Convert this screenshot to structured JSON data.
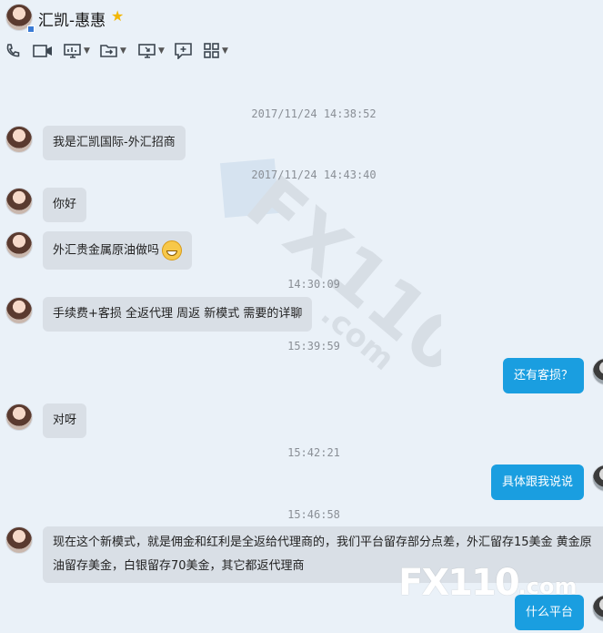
{
  "header": {
    "contact_name": "汇凯-惠惠",
    "status": "online",
    "star_icon": "star-icon"
  },
  "toolbar": {
    "items": [
      "phone-icon",
      "video-icon",
      "screen-share-icon",
      "file-transfer-icon",
      "remote-desktop-icon",
      "add-chat-icon",
      "apps-grid-icon"
    ]
  },
  "timestamps": {
    "t1": "2017/11/24 14:38:52",
    "t2": "2017/11/24 14:43:40",
    "t3": "14:30:09",
    "t4": "15:39:59",
    "t5": "15:42:21",
    "t6": "15:46:58"
  },
  "messages": {
    "m1": "我是汇凯国际-外汇招商",
    "m2": "你好",
    "m3": "外汇贵金属原油做吗",
    "m4": "手续费+客损  全返代理  周返  新模式  需要的详聊",
    "m5": "还有客损？",
    "m6": "对呀",
    "m7": "具体跟我说说",
    "m8_line1": "现在这个新模式，就是佣金和红利是全返给代理商的，我们平台留存部分点差，外汇留存15美金   黄金原",
    "m8_line2": "油留存美金，白银留存70美金，其它都返代理商",
    "m9": "什么平台"
  },
  "watermark": {
    "logo": "FX110",
    "domain": ".com"
  },
  "colors": {
    "background": "#eaf1f8",
    "incoming_bubble": "#d9dfe6",
    "outgoing_bubble": "#1a9ee0"
  }
}
